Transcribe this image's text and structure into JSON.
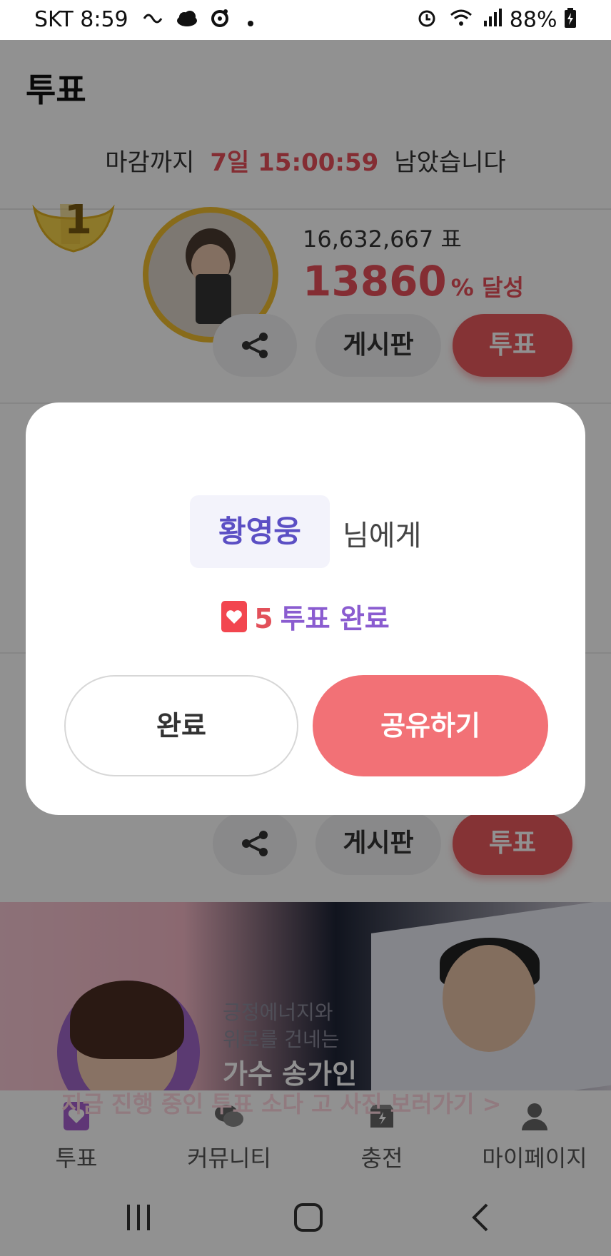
{
  "status_bar": {
    "carrier_time": "SKT 8:59",
    "battery": "88%",
    "icons_left": [
      "link-icon",
      "cloud-icon",
      "record-icon",
      "dot-icon"
    ],
    "icons_right": [
      "alarm-icon",
      "wifi-icon",
      "signal-icon",
      "battery-charging-icon"
    ]
  },
  "header": {
    "title": "투표",
    "deadline_prefix": "마감까지",
    "deadline_time": "7일 15:00:59",
    "deadline_suffix": "남았습니다"
  },
  "rank_card": {
    "rank": "1",
    "votes": "16,632,667 표",
    "percent": "13860",
    "percent_unit": "% 달성",
    "board_label": "게시판",
    "vote_label": "투표"
  },
  "second_card": {
    "board_label": "게시판",
    "vote_label": "투표"
  },
  "banner": {
    "line1": "긍정에너지와",
    "line2": "위로를 건네는",
    "line3": "가수 송가인",
    "cta": "지금 진행 중인 투표 소다 고 사진 보러가기 >"
  },
  "modal": {
    "target_name": "황영웅",
    "target_suffix": "님에게",
    "vote_count": "5",
    "vote_result": "투표 완료",
    "done_label": "완료",
    "share_label": "공유하기"
  },
  "bottom_nav": {
    "items": [
      {
        "label": "투표",
        "icon": "vote-heart-icon"
      },
      {
        "label": "커뮤니티",
        "icon": "chat-bubbles-icon"
      },
      {
        "label": "충전",
        "icon": "charge-box-icon"
      },
      {
        "label": "마이페이지",
        "icon": "person-icon"
      }
    ]
  },
  "colors": {
    "accent": "#ea5a5e",
    "share_button": "#f27176",
    "target_name": "#5b4fc4",
    "gold": "#f0bd2e"
  }
}
